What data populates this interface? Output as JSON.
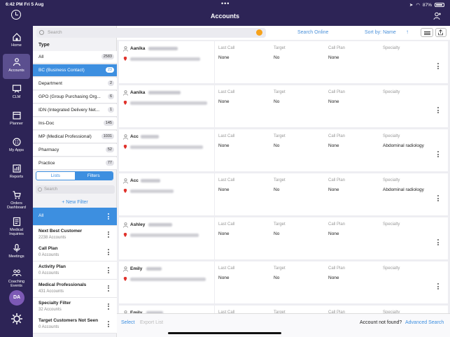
{
  "status": {
    "time": "6:42 PM",
    "date": "Fri 5 Aug",
    "battery": "87%"
  },
  "header": {
    "title": "Accounts"
  },
  "rail": [
    {
      "label": "Home",
      "icon": "home-icon"
    },
    {
      "label": "Accounts",
      "icon": "accounts-icon"
    },
    {
      "label": "CLM",
      "icon": "clm-icon"
    },
    {
      "label": "Planner",
      "icon": "planner-icon"
    },
    {
      "label": "My Apps",
      "icon": "apps-icon"
    },
    {
      "label": "Reports",
      "icon": "reports-icon"
    },
    {
      "label": "Orders Dashboard",
      "icon": "orders-icon"
    },
    {
      "label": "Medical Inquiries",
      "icon": "inquiries-icon"
    },
    {
      "label": "Meetings",
      "icon": "meetings-icon"
    },
    {
      "label": "Coaching Events",
      "icon": "coaching-icon"
    }
  ],
  "avatar": "DA",
  "search": {
    "placeholder": "Search",
    "online": "Search Online",
    "sort": "Sort by: Name",
    "sort_arrow": "↑"
  },
  "types": {
    "header": "Type",
    "items": [
      {
        "label": "All",
        "count": "2583"
      },
      {
        "label": "BC (Business Contact)",
        "count": "23"
      },
      {
        "label": "Department",
        "count": "2"
      },
      {
        "label": "GPO (Group Purchasing Org...",
        "count": "6"
      },
      {
        "label": "IDN (Integrated Delivery Net...",
        "count": "1"
      },
      {
        "label": "Ins-Doc",
        "count": "145"
      },
      {
        "label": "MP (Medical Professional)",
        "count": "1031"
      },
      {
        "label": "Pharmacy",
        "count": "52"
      },
      {
        "label": "Practice",
        "count": "77"
      }
    ]
  },
  "segment": {
    "lists": "Lists",
    "filters": "Filters"
  },
  "filter_search": {
    "placeholder": "Search"
  },
  "new_filter": "+ New Filter",
  "filters": [
    {
      "name": "All",
      "count": ""
    },
    {
      "name": "Next Best Customer",
      "count": "2238 Accounts"
    },
    {
      "name": "Call Plan",
      "count": "0 Accounts"
    },
    {
      "name": "Activity Plan",
      "count": "0 Accounts"
    },
    {
      "name": "Medical Professionals",
      "count": "431 Accounts"
    },
    {
      "name": "Specialty Filter",
      "count": "32 Accounts"
    },
    {
      "name": "Target Customers Not Seen",
      "count": "0 Accounts"
    }
  ],
  "columns": {
    "last_call": "Last Call",
    "target": "Target",
    "call_plan": "Call Plan",
    "specialty": "Specialty"
  },
  "accounts": [
    {
      "name": "Aanika",
      "last_call": "None",
      "target": "No",
      "call_plan": "None",
      "specialty": ""
    },
    {
      "name": "Aanika",
      "last_call": "None",
      "target": "No",
      "call_plan": "None",
      "specialty": ""
    },
    {
      "name": "Acc",
      "last_call": "None",
      "target": "No",
      "call_plan": "None",
      "specialty": "Abdominal radiology"
    },
    {
      "name": "Acc",
      "last_call": "None",
      "target": "No",
      "call_plan": "None",
      "specialty": "Abdominal radiology"
    },
    {
      "name": "Ashley",
      "last_call": "None",
      "target": "No",
      "call_plan": "None",
      "specialty": ""
    },
    {
      "name": "Emily",
      "last_call": "None",
      "target": "No",
      "call_plan": "None",
      "specialty": ""
    },
    {
      "name": "Emily",
      "last_call": "",
      "target": "",
      "call_plan": "",
      "specialty": ""
    }
  ],
  "bottom": {
    "select": "Select",
    "export": "Export List",
    "not_found": "Account not found?",
    "advanced": "Advanced Search"
  }
}
